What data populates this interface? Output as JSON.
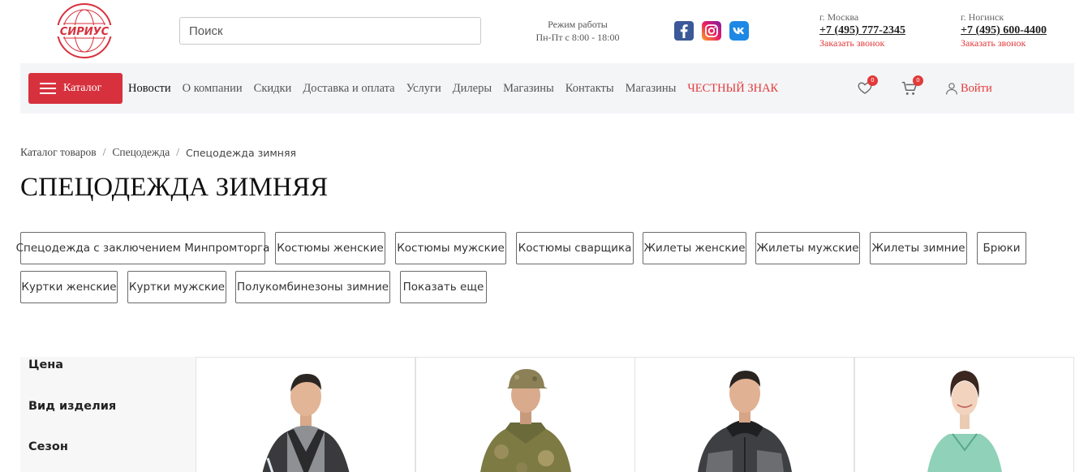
{
  "header": {
    "logo_text": "СИРИУС",
    "search_placeholder": "Поиск",
    "hours_title": "Режим работы",
    "hours_value": "Пн-Пт с 8:00 - 18:00",
    "social": [
      "facebook-icon",
      "instagram-icon",
      "vk-icon"
    ],
    "contacts": [
      {
        "city": "г. Москва",
        "phone": "+7 (495) 777-2345",
        "callback": "Заказать звонок"
      },
      {
        "city": "г. Ногинск",
        "phone": "+7 (495) 600-4400",
        "callback": "Заказать звонок"
      }
    ]
  },
  "nav": {
    "catalog_label": "Каталог",
    "links": [
      "Новости",
      "О компании",
      "Скидки",
      "Доставка и оплата",
      "Услуги",
      "Дилеры",
      "Магазины",
      "Контакты",
      "Магазины",
      "ЧЕСТНЫЙ ЗНАК"
    ],
    "favorites_count": "0",
    "cart_count": "0",
    "login_label": "Войти"
  },
  "breadcrumb": [
    "Каталог товаров",
    "Спецодежда",
    "Спецодежда зимняя"
  ],
  "page_title": "СПЕЦОДЕЖДА ЗИМНЯЯ",
  "categories": [
    "Спецодежда с заключением Минпромторга",
    "Костюмы женские",
    "Костюмы мужские",
    "Костюмы сварщика",
    "Жилеты женские",
    "Жилеты мужские",
    "Жилеты зимние",
    "Брюки",
    "Куртки женские",
    "Куртки мужские",
    "Полукомбинезоны зимние",
    "Показать еще"
  ],
  "filters": [
    "Цена",
    "Вид изделия",
    "Сезон"
  ],
  "colors": {
    "accent": "#d7313d",
    "link_red": "#e23a3a",
    "nav_bg": "#f4f5f7"
  }
}
